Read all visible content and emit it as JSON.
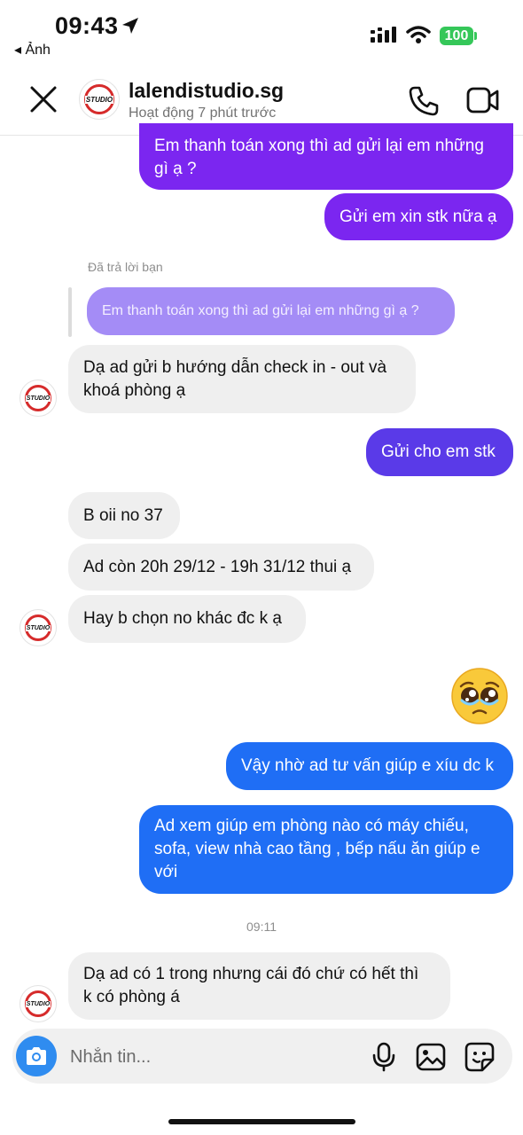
{
  "status_bar": {
    "time": "09:43",
    "back_label": "◂ Ảnh",
    "battery": "100"
  },
  "header": {
    "name": "lalendistudio.sg",
    "status": "Hoạt động 7 phút trước",
    "avatar_text": "STUDIO"
  },
  "messages": {
    "m1": "Em thanh toán xong thì ad gửi lại em những\ngì ạ ?",
    "m2": "Gửi em xin stk nữa ạ",
    "reply_label": "Đã trả lời bạn",
    "reply_quote": "Em thanh toán xong thì ad gửi lại em những gì ạ ?",
    "m3": "Dạ ad gửi b hướng dẫn check in - out và\nkhoá phòng ạ",
    "m4": "Gửi cho em stk",
    "m5": "B oii no 37",
    "m6": "Ad còn 20h 29/12 - 19h 31/12 thui ạ",
    "m7": "Hay b chọn no khác đc k ạ",
    "m8": "Vậy nhờ ad tư vấn giúp e xíu dc k",
    "m9": "Ad xem giúp em phòng nào có máy chiếu,\nsofa, view nhà cao tầng , bếp nấu ăn giúp e\nvới",
    "timestamp": "09:11",
    "m10": "Dạ ad có 1 trong nhưng cái đó chứ có hết thì\nk có phòng á"
  },
  "composer": {
    "placeholder": "Nhắn tin..."
  },
  "colors": {
    "purple": "#7b26f0",
    "indigo": "#5a3ae8",
    "blue": "#1f6ef5",
    "incoming": "#efefef",
    "camera": "#2f8cf0"
  },
  "icons": [
    "location-arrow-icon",
    "signal-icon",
    "wifi-icon",
    "battery-icon",
    "close-icon",
    "phone-icon",
    "video-icon",
    "camera-icon",
    "microphone-icon",
    "gallery-icon",
    "sticker-icon",
    "pleading-face-emoji"
  ]
}
